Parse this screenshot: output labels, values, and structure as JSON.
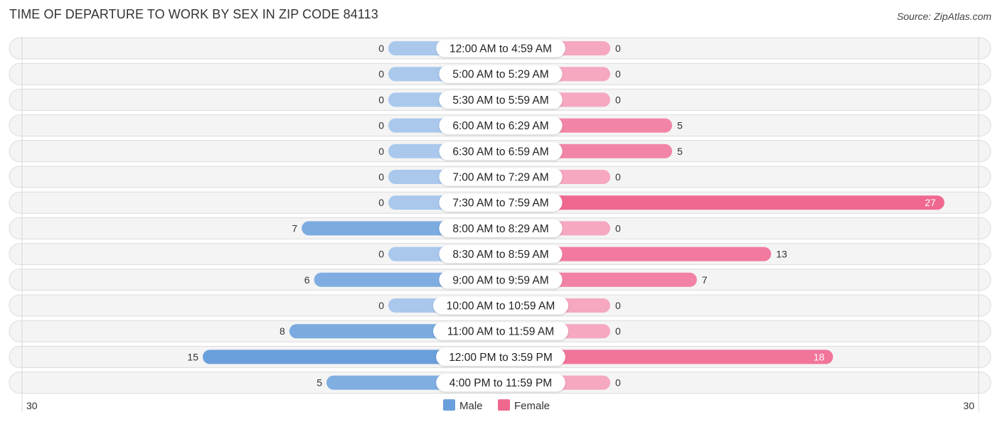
{
  "title": "TIME OF DEPARTURE TO WORK BY SEX IN ZIP CODE 84113",
  "source": "Source: ZipAtlas.com",
  "colors": {
    "male": "#6a9fdb",
    "male_light": "#a9c8ec",
    "female": "#f06890",
    "female_light": "#f5a8c0"
  },
  "chart_data": {
    "type": "bar",
    "orientation": "horizontal-diverging",
    "title": "TIME OF DEPARTURE TO WORK BY SEX IN ZIP CODE 84113",
    "categories": [
      "12:00 AM to 4:59 AM",
      "5:00 AM to 5:29 AM",
      "5:30 AM to 5:59 AM",
      "6:00 AM to 6:29 AM",
      "6:30 AM to 6:59 AM",
      "7:00 AM to 7:29 AM",
      "7:30 AM to 7:59 AM",
      "8:00 AM to 8:29 AM",
      "8:30 AM to 8:59 AM",
      "9:00 AM to 9:59 AM",
      "10:00 AM to 10:59 AM",
      "11:00 AM to 11:59 AM",
      "12:00 PM to 3:59 PM",
      "4:00 PM to 11:59 PM"
    ],
    "series": [
      {
        "name": "Male",
        "values": [
          0,
          0,
          0,
          0,
          0,
          0,
          0,
          7,
          0,
          6,
          0,
          8,
          15,
          5
        ]
      },
      {
        "name": "Female",
        "values": [
          0,
          0,
          0,
          5,
          5,
          0,
          27,
          0,
          13,
          7,
          0,
          0,
          18,
          0
        ]
      }
    ],
    "axis": {
      "left_label": "30",
      "right_label": "30",
      "max": 30
    },
    "legend": {
      "position": "bottom-center",
      "entries": [
        "Male",
        "Female"
      ]
    },
    "grid": false
  }
}
